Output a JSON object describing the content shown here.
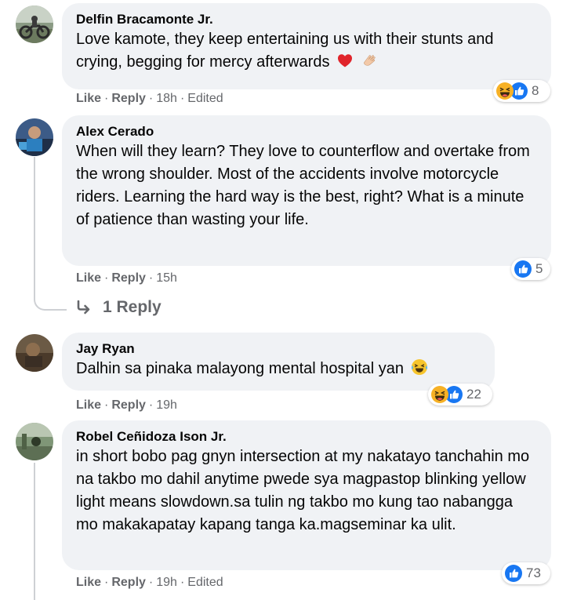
{
  "comments": [
    {
      "author": "Delfin Bracamonte Jr.",
      "text": "Love kamote, they keep entertaining us with their stunts and crying, begging for mercy afterwards",
      "emojis": [
        "red-heart",
        "clapping-hands"
      ],
      "actions": {
        "like": "Like",
        "reply": "Reply",
        "time": "18h",
        "edited": "Edited"
      },
      "reactions": {
        "icons": [
          "haha",
          "like"
        ],
        "count": "8"
      }
    },
    {
      "author": "Alex Cerado",
      "text": "When will they learn? They love to counterflow and overtake from the wrong shoulder. Most of the accidents involve motorcycle riders. Learning the hard way is the best, right? What is a minute of patience than wasting your life.",
      "actions": {
        "like": "Like",
        "reply": "Reply",
        "time": "15h"
      },
      "reactions": {
        "icons": [
          "like"
        ],
        "count": "5"
      },
      "replies_label": "1 Reply"
    },
    {
      "author": "Jay Ryan",
      "text": "Dalhin sa pinaka malayong mental hospital yan",
      "emojis": [
        "tears-of-joy"
      ],
      "actions": {
        "like": "Like",
        "reply": "Reply",
        "time": "19h"
      },
      "reactions": {
        "icons": [
          "haha",
          "like"
        ],
        "count": "22"
      }
    },
    {
      "author": "Robel Ceñidoza Ison Jr.",
      "text": "in short bobo pag gnyn intersection at my nakatayo tanchahin mo na takbo mo dahil anytime pwede sya magpastop blinking yellow light means slowdown.sa tulin ng takbo mo kung tao nabangga mo makakapatay kapang tanga ka.magseminar ka ulit.",
      "actions": {
        "like": "Like",
        "reply": "Reply",
        "time": "19h",
        "edited": "Edited"
      },
      "reactions": {
        "icons": [
          "like"
        ],
        "count": "73"
      }
    }
  ],
  "colors": {
    "like_blue": "#1877f2",
    "bubble": "#f0f2f5",
    "meta": "#65676b",
    "haha": "#f7b125"
  }
}
